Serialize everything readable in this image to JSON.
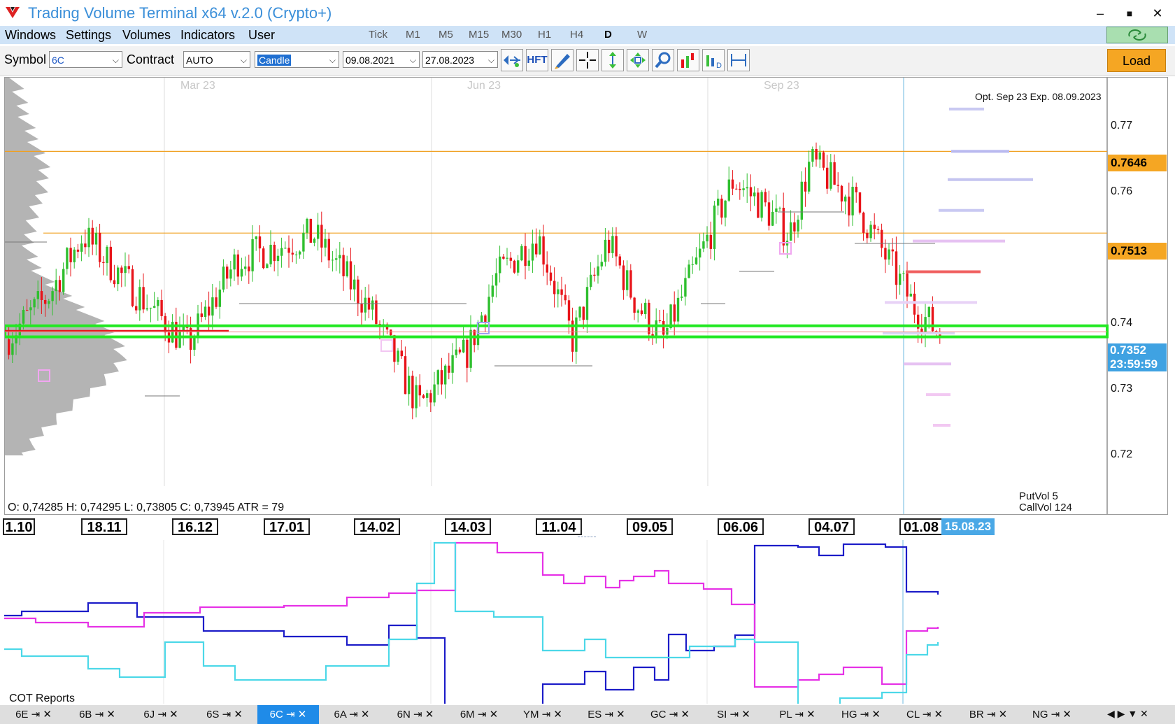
{
  "window": {
    "title": "Trading Volume Terminal x64 v.2.0 (Crypto+)",
    "minimize": "–",
    "maximize": "■",
    "close": "✕"
  },
  "menu": [
    "Windows",
    "Settings",
    "Volumes",
    "Indicators",
    "User"
  ],
  "timeframes": [
    "Tick",
    "M1",
    "M5",
    "M15",
    "M30",
    "H1",
    "H4",
    "D",
    "W"
  ],
  "active_timeframe": "D",
  "toolbar": {
    "symbol_label": "Symbol",
    "symbol_value": "6C",
    "contract_label": "Contract",
    "contract_value": "AUTO",
    "chart_type": "Candle",
    "date_from": "09.08.2021",
    "date_to": "27.08.2023",
    "hft_label": "HFT",
    "load_label": "Load",
    "tool_icons": [
      "volume-profile-icon",
      "hft-icon",
      "pencil-icon",
      "crosshair-icon",
      "vertical-scale-icon",
      "move-icon",
      "zoom-icon",
      "bar-volume-icon",
      "delta-icon",
      "range-icon"
    ]
  },
  "chart": {
    "month_labels": [
      "Mar 23",
      "Jun 23",
      "Sep 23"
    ],
    "option_label": "Opt. Sep 23 Exp. 08.09.2023",
    "price_ticks": [
      "0.77",
      "0.76",
      "0.74",
      "0.73",
      "0.72"
    ],
    "level_high": "0.7646",
    "level_mid": "0.7513",
    "current_price": "0.7352",
    "countdown": "23:59:59",
    "ohlc_text": "O: 0,74285  H: 0,74295  L: 0,73805  C: 0,73945  ATR = 79",
    "put_vol": "PutVol  5",
    "call_vol": "CallVol  124",
    "colors": {
      "up": "#2fbf2f",
      "down": "#e8141a",
      "level": "#f0a020",
      "zone": "#22e822",
      "profile": "#b4b4b4"
    }
  },
  "dates": [
    "1.10",
    "18.11",
    "16.12",
    "17.01",
    "14.02",
    "14.03",
    "11.04",
    "09.05",
    "06.06",
    "04.07",
    "01.08"
  ],
  "current_date": "15.08.23",
  "cot": {
    "title": "COT Reports",
    "colors": [
      "#1c1cc8",
      "#e632e6",
      "#4cd8e8"
    ]
  },
  "symbols": [
    "6E",
    "6B",
    "6J",
    "6S",
    "6C",
    "6A",
    "6N",
    "6M",
    "YM",
    "ES",
    "GC",
    "SI",
    "PL",
    "HG",
    "CL",
    "BR",
    "NG"
  ],
  "active_symbol": "6C"
}
